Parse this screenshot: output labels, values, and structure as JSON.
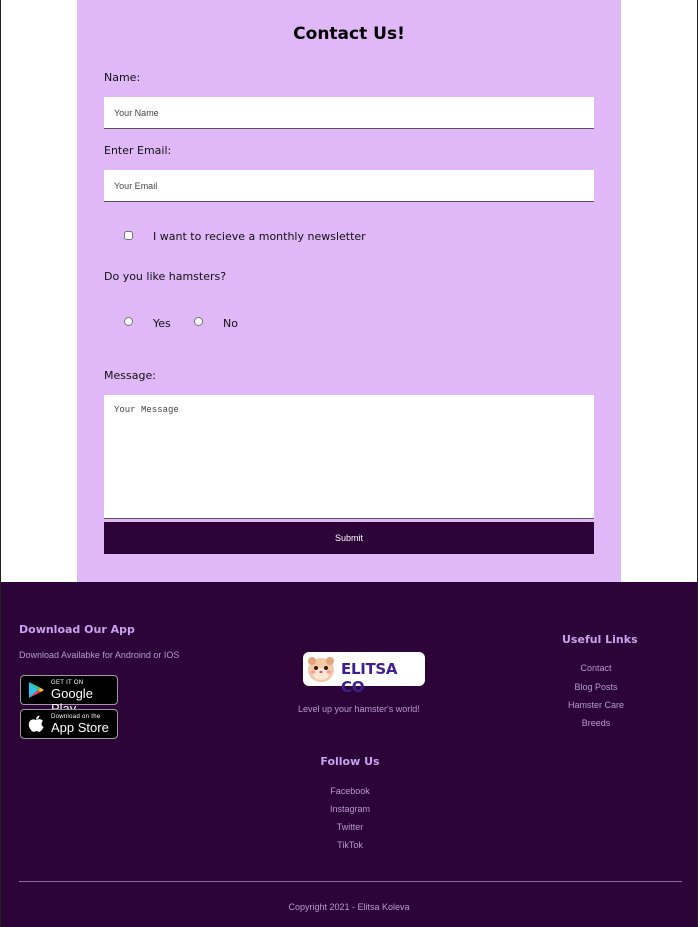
{
  "form": {
    "title": "Contact Us!",
    "name_label": "Name:",
    "name_placeholder": "Your Name",
    "email_label": "Enter Email:",
    "email_placeholder": "Your Email",
    "newsletter_label": "I want to recieve a monthly newsletter",
    "newsletter_checked": false,
    "hamster_question": "Do you like hamsters?",
    "radio_options": [
      "Yes",
      "No"
    ],
    "message_label": "Message:",
    "message_placeholder": "Your Message",
    "submit_label": "Submit",
    "card_color": "#e0b8f7",
    "button_color": "#2c0438"
  },
  "footer": {
    "background": "#2c0438",
    "app": {
      "heading": "Download Our App",
      "subtext": "Download Availabke for Androind or IOS",
      "google_play": {
        "small": "GET IT ON",
        "big": "Google Play",
        "icon": "google-play-icon"
      },
      "app_store": {
        "small": "Download on the",
        "big": "App Store",
        "icon": "apple-icon"
      }
    },
    "brand": {
      "logo_text": "ELITSA CO",
      "tagline": "Level up your hamster's world!"
    },
    "follow": {
      "heading": "Follow Us",
      "links": [
        "Facebook",
        "Instagram",
        "Twitter",
        "TikTok"
      ]
    },
    "useful": {
      "heading": "Useful Links",
      "links": [
        "Contact",
        "Blog Posts",
        "Hamster Care",
        "Breeds"
      ]
    },
    "copyright": "Copyright 2021 - Elitsa Koleva"
  }
}
